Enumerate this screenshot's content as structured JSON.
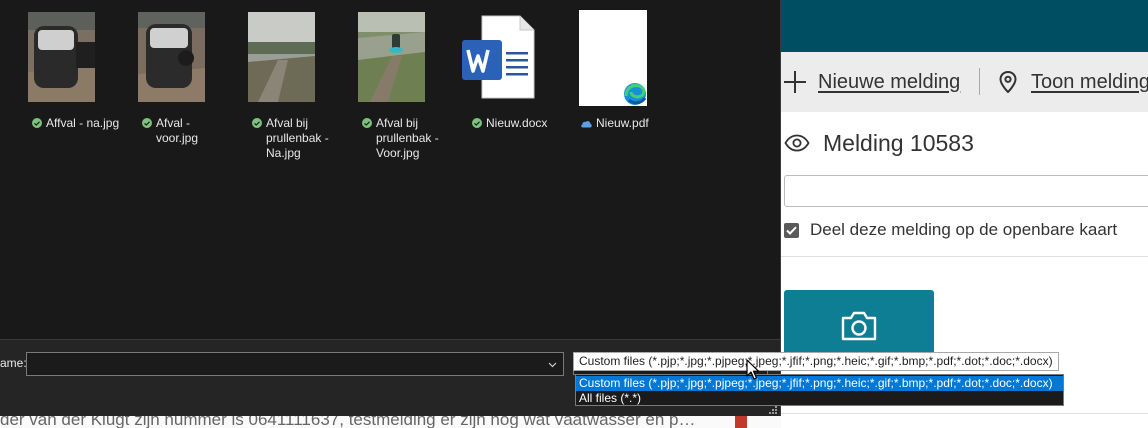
{
  "web": {
    "actions": {
      "new_report": "Nieuwe melding",
      "show_reports": "Toon melding"
    },
    "melding_title": "Melding 10583",
    "share_checkbox": {
      "label": "Deel deze melding op de openbare kaart",
      "checked": true
    },
    "photo_button_icon": "camera-icon",
    "colors": {
      "header": "#004e62",
      "actionbar": "#ececec",
      "photo_button": "#0e7e94"
    }
  },
  "background_text": "der van der Klugt zijn nummer is 0641111637, testmelding er zijn nog wat vaatwasser en p…",
  "dialog": {
    "files": [
      {
        "name": "Affval - na.jpg",
        "status": "synced"
      },
      {
        "name": "Afval - voor.jpg",
        "status": "synced"
      },
      {
        "name": "Afval bij prullenbak - Na.jpg",
        "status": "synced"
      },
      {
        "name": "Afval bij prullenbak - Voor.jpg",
        "status": "synced"
      },
      {
        "name": "Nieuw.docx",
        "status": "synced"
      },
      {
        "name": "Nieuw.pdf",
        "status": "cloud"
      }
    ],
    "filename_label": "ame:",
    "filename_value": "",
    "filter_tooltip": "Custom files (*.pjp;*.jpg;*.pjpeg;*.jpeg;*.jfif;*.png;*.heic;*.gif;*.bmp;*.pdf;*.dot;*.doc;*.docx)",
    "filter_options": [
      "Custom files (*.pjp;*.jpg;*.pjpeg;*.jpeg;*.jfif;*.png;*.heic;*.gif;*.bmp;*.pdf;*.dot;*.doc;*.docx)",
      "All files (*.*)"
    ],
    "selected_filter_index": 0,
    "colors": {
      "background": "#191919",
      "selection": "#0078d7",
      "sync_ok": "#7ec07e",
      "cloud": "#5aa0e6"
    }
  }
}
